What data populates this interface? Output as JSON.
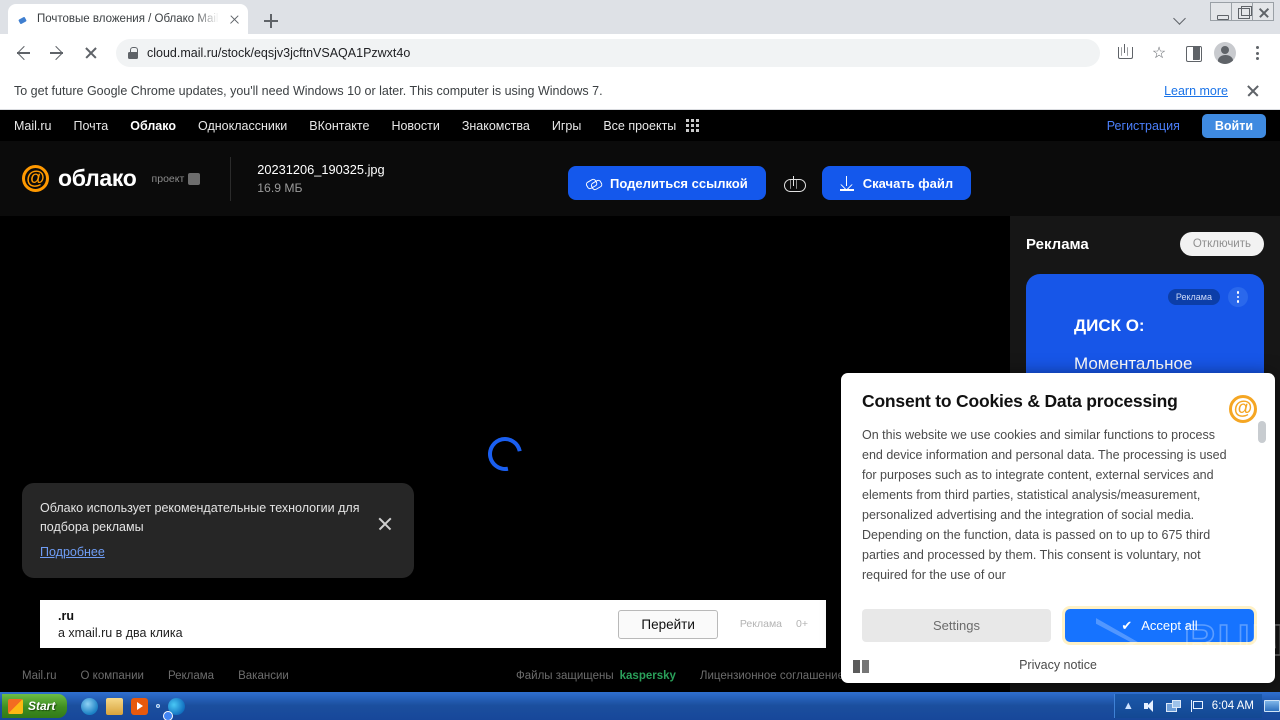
{
  "browser": {
    "tab": {
      "title": "Почтовые вложения / Облако Mail",
      "favicon_icon": "site-favicon"
    },
    "newtab_label": "+",
    "url": {
      "host": "cloud.mail.ru",
      "path": "/stock/eqsjv3jcftnVSAQA1Pzwxt4o",
      "full": "cloud.mail.ru/stock/eqsjv3jcftnVSAQA1Pzwxt4o"
    },
    "infobar": {
      "message": "To get future Google Chrome updates, you'll need Windows 10 or later. This computer is using Windows 7.",
      "learn_more": "Learn more"
    }
  },
  "mailru_nav": {
    "links": [
      {
        "label": "Mail.ru",
        "bold": false
      },
      {
        "label": "Почта",
        "bold": false
      },
      {
        "label": "Облако",
        "bold": true
      },
      {
        "label": "Одноклассники",
        "bold": false
      },
      {
        "label": "ВКонтакте",
        "bold": false
      },
      {
        "label": "Новости",
        "bold": false
      },
      {
        "label": "Знакомства",
        "bold": false
      },
      {
        "label": "Игры",
        "bold": false
      },
      {
        "label": "Все проекты",
        "bold": false
      }
    ],
    "register": "Регистрация",
    "login": "Войти"
  },
  "cloud_header": {
    "logo_word": "облако",
    "logo_sub": "проект",
    "file_name": "20231206_190325.jpg",
    "file_size": "16.9 МБ",
    "share_button": "Поделиться ссылкой",
    "download_button": "Скачать файл",
    "upload_icon": "cloud-upload-icon"
  },
  "viewer": {
    "state": "loading",
    "spinner_color": "#1a5ff0"
  },
  "ad_rail": {
    "title": "Реклама",
    "disable_button": "Отключить",
    "card": {
      "badge": "Реклама",
      "brand": "ДИСК О:",
      "text": "Моментальное перемещение файлов между облаками"
    }
  },
  "bottom_banner": {
    "line1": ".ru",
    "line2": "а xmail.ru в два клика",
    "button": "Перейти",
    "meta_label": "Реклама",
    "meta_age": "0+"
  },
  "page_footer": {
    "left_links": [
      "Mail.ru",
      "О компании",
      "Реклама",
      "Вакансии"
    ],
    "protected_label": "Файлы защищены",
    "protected_brand": "kaspersky",
    "license": "Лицензионное соглашение"
  },
  "toast": {
    "text": "Облако использует рекомендательные технологии для подбора рекламы",
    "link": "Подробнее",
    "close_icon": "close-icon"
  },
  "consent": {
    "title": "Consent to Cookies & Data processing",
    "body": "On this website we use cookies and similar functions to process end device information and personal data. The processing is used for purposes such as to integrate content, external services and elements from third parties, statistical analysis/measurement, personalized advertising and the integration of social media. Depending on the function, data is passed on to up to 675 third parties and processed by them. This consent is voluntary, not required for the use of our",
    "settings_button": "Settings",
    "accept_button": "Accept all",
    "accept_check_icon": "check-icon",
    "privacy_link": "Privacy notice",
    "logo_icon": "mailru-at-icon"
  },
  "watermark": {
    "text": "ANY",
    "text2": "RUN"
  },
  "taskbar": {
    "start_label": "Start",
    "quick_launch": [
      "internet-explorer-icon",
      "folder-icon",
      "media-player-icon",
      "chrome-icon",
      "edge-icon"
    ],
    "clock": "6:04 AM",
    "tray_icons": [
      "chevron-up-icon",
      "volume-icon",
      "network-icon",
      "flag-icon",
      "show-desktop-icon"
    ]
  }
}
